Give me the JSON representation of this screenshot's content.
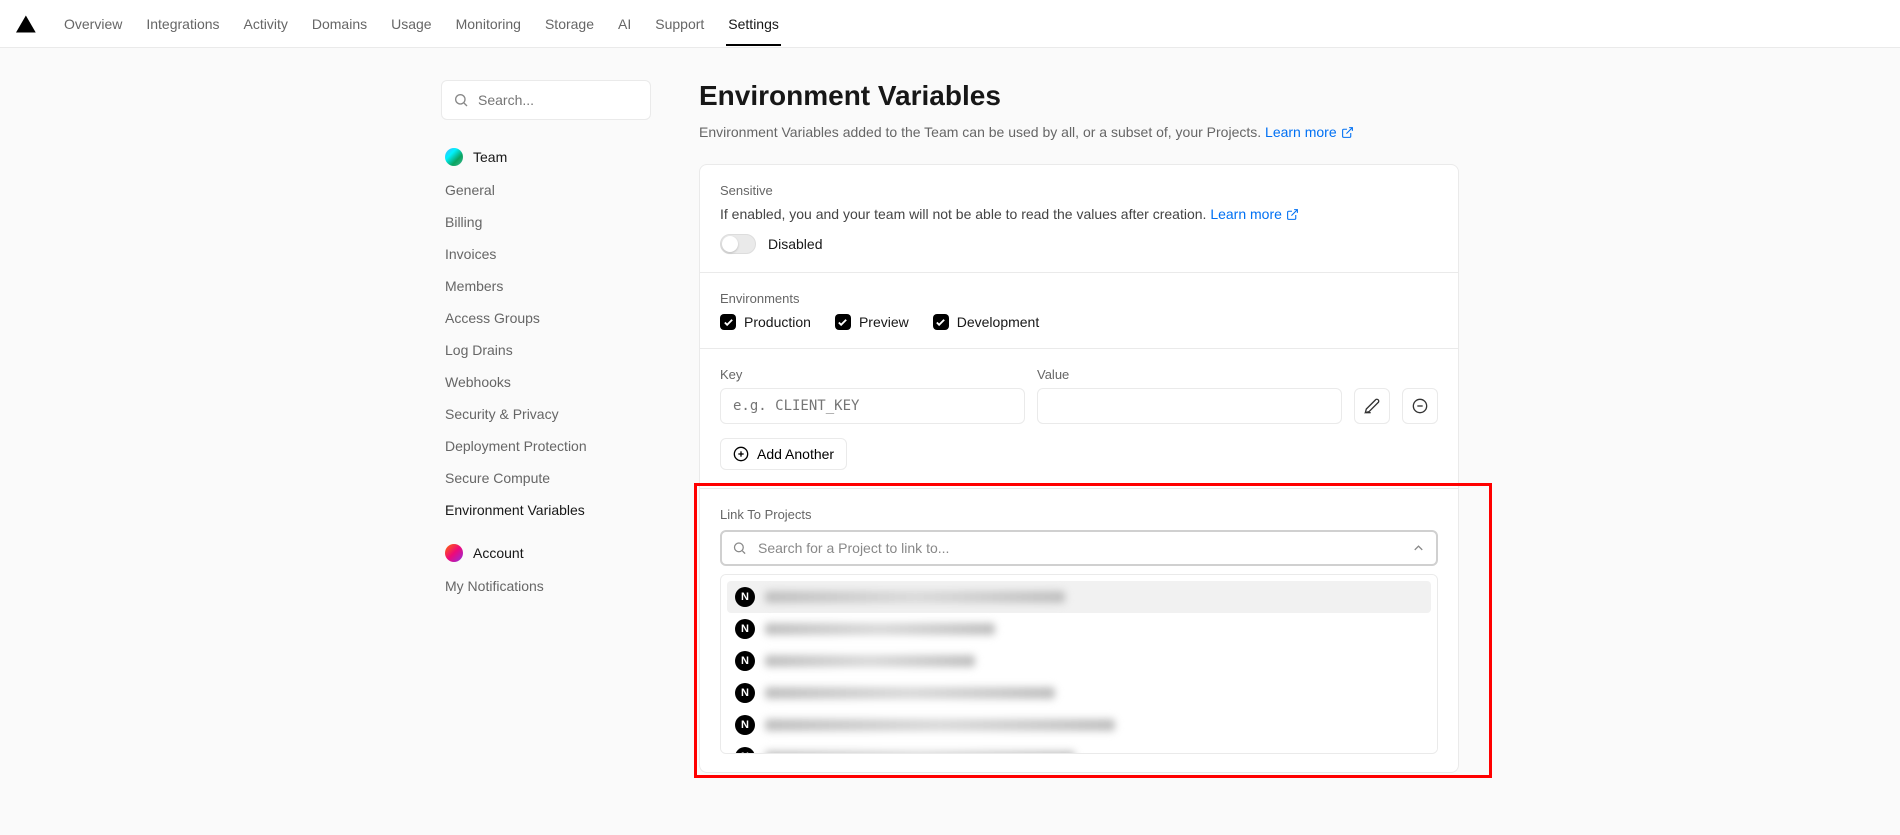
{
  "topnav": {
    "tabs": [
      "Overview",
      "Integrations",
      "Activity",
      "Domains",
      "Usage",
      "Monitoring",
      "Storage",
      "AI",
      "Support",
      "Settings"
    ],
    "active": "Settings"
  },
  "sidebar": {
    "search_placeholder": "Search...",
    "team_label": "Team",
    "items": [
      "General",
      "Billing",
      "Invoices",
      "Members",
      "Access Groups",
      "Log Drains",
      "Webhooks",
      "Security & Privacy",
      "Deployment Protection",
      "Secure Compute",
      "Environment Variables"
    ],
    "active": "Environment Variables",
    "account_label": "Account",
    "account_items": [
      "My Notifications"
    ]
  },
  "page": {
    "title": "Environment Variables",
    "description": "Environment Variables added to the Team can be used by all, or a subset of, your Projects. ",
    "learn_more": "Learn more"
  },
  "sensitive": {
    "label": "Sensitive",
    "text": "If enabled, you and your team will not be able to read the values after creation. ",
    "learn_more": "Learn more",
    "toggle_state": "Disabled"
  },
  "environments": {
    "label": "Environments",
    "options": [
      "Production",
      "Preview",
      "Development"
    ]
  },
  "kv": {
    "key_label": "Key",
    "key_placeholder": "e.g. CLIENT_KEY",
    "value_label": "Value",
    "add_another": "Add Another"
  },
  "link_projects": {
    "label": "Link To Projects",
    "search_placeholder": "Search for a Project to link to...",
    "items_count": 6,
    "item_widths": [
      300,
      230,
      210,
      290,
      350,
      310
    ]
  }
}
